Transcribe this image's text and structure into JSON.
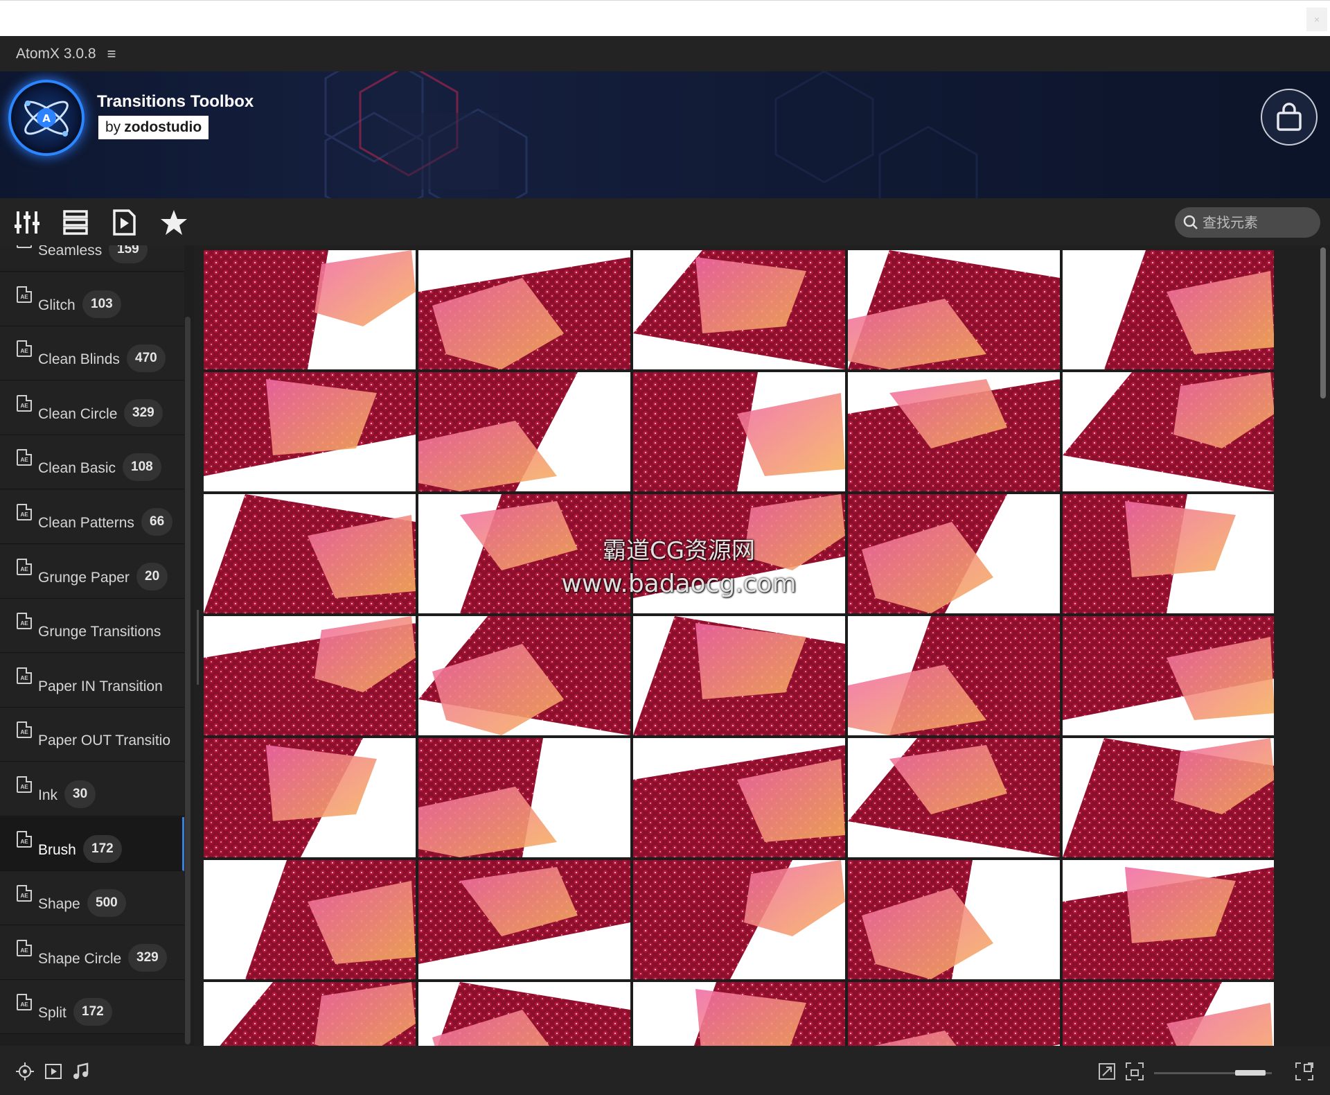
{
  "window": {
    "title": "AtomX 3.0.8",
    "close_glyph": "×"
  },
  "banner": {
    "title": "Transitions Toolbox",
    "by_prefix": "by",
    "by_author": "zodostudio"
  },
  "toolbar": {
    "icons": [
      "sliders-icon",
      "list-icon",
      "video-file-icon",
      "star-icon"
    ]
  },
  "search": {
    "placeholder": "查找元素"
  },
  "sidebar": {
    "items": [
      {
        "label": "Seamless",
        "count": "159"
      },
      {
        "label": "Glitch",
        "count": "103"
      },
      {
        "label": "Clean Blinds",
        "count": "470"
      },
      {
        "label": "Clean Circle",
        "count": "329"
      },
      {
        "label": "Clean Basic",
        "count": "108"
      },
      {
        "label": "Clean Patterns",
        "count": "66"
      },
      {
        "label": "Grunge Paper",
        "count": "20"
      },
      {
        "label": "Grunge Transitions",
        "count": ""
      },
      {
        "label": "Paper IN Transition",
        "count": ""
      },
      {
        "label": "Paper OUT Transitio",
        "count": ""
      },
      {
        "label": "Ink",
        "count": "30"
      },
      {
        "label": "Brush",
        "count": "172",
        "active": true
      },
      {
        "label": "Shape",
        "count": "500"
      },
      {
        "label": "Shape Circle",
        "count": "329"
      },
      {
        "label": "Split",
        "count": "172"
      }
    ]
  },
  "watermark": {
    "line1": "霸道CG资源网",
    "line2": "www.badaocg.com"
  },
  "colors": {
    "accent": "#3b7ed9",
    "panel_bg": "#202020",
    "pomegranate": "#8a0f2c",
    "brush_pink": "#f06aa6",
    "brush_orange": "#f6b25a"
  },
  "bottombar": {
    "icons": [
      "target-icon",
      "play-preview-icon",
      "music-note-icon",
      "resize-icon",
      "fit-frame-icon",
      "fullscreen-icon"
    ]
  }
}
